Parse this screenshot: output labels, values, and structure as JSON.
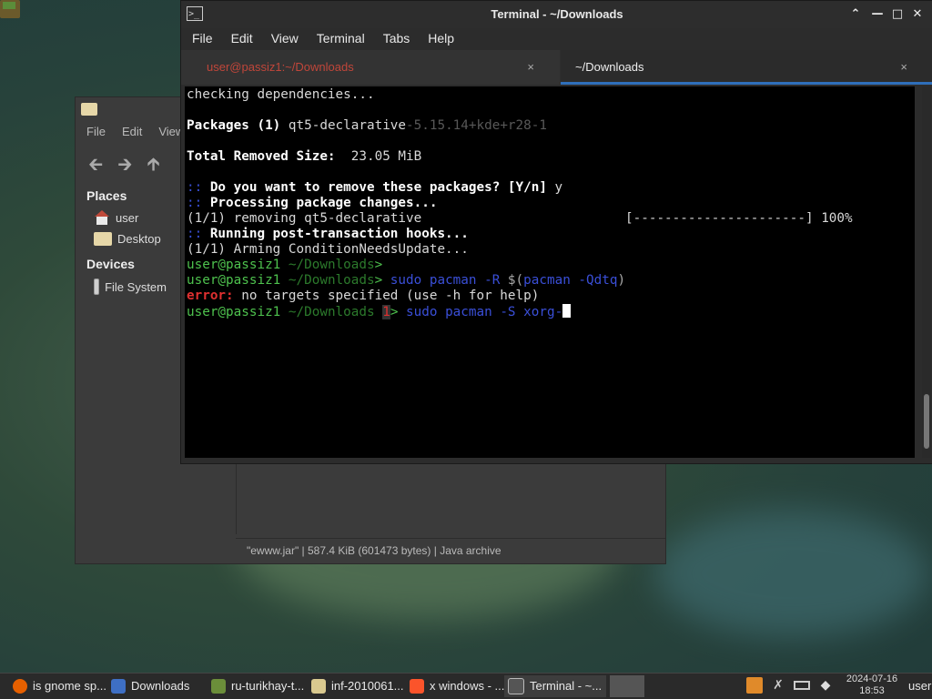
{
  "file_manager": {
    "menu": [
      "File",
      "Edit",
      "View"
    ],
    "places_header": "Places",
    "devices_header": "Devices",
    "places": [
      "user",
      "Desktop"
    ],
    "devices": [
      "File System"
    ],
    "status": "\"ewww.jar\"  |  587.4 KiB (601473 bytes)  |  Java archive"
  },
  "terminal": {
    "title": "Terminal - ~/Downloads",
    "menu": [
      "File",
      "Edit",
      "View",
      "Terminal",
      "Tabs",
      "Help"
    ],
    "tabs": [
      {
        "label": "user@passiz1:~/Downloads",
        "active": false
      },
      {
        "label": "~/Downloads",
        "active": true
      }
    ],
    "close_glyph": "×",
    "lines": {
      "l1": "checking dependencies...",
      "l3_a": "Packages (1) ",
      "l3_b": "qt5-declarative",
      "l3_c": "-5.15.14+kde+r28-1",
      "l5_a": "Total Removed Size:",
      "l5_b": "  23.05 MiB",
      "prompt_marks": "::",
      "l7": " Do you want to remove these packages? [Y/n]",
      "l7_ans": " y",
      "l8": " Processing package changes...",
      "l9": "(1/1) removing qt5-declarative                          [----------------------] 100%",
      "l10": " Running post-transaction hooks...",
      "l11": "(1/1) Arming ConditionNeedsUpdate...",
      "prompt_user": "user@passiz1",
      "prompt_dir": " ~/Downloads",
      "prompt_end": ">",
      "cmd1_a": " sudo",
      "cmd1_b": " pacman -R",
      "cmd1_c": " $(",
      "cmd1_d": "pacman",
      "cmd1_e": " -Qdtq",
      "cmd1_f": ")",
      "err_a": "error:",
      "err_b": " no targets specified (use -h for help)",
      "code": "1",
      "cmd2_a": " sudo",
      "cmd2_b": " pacman -S xorg-"
    }
  },
  "taskbar": {
    "items": [
      {
        "label": "is gnome sp...",
        "icon": "firefox-icon",
        "color": "#e66000"
      },
      {
        "label": "Downloads",
        "icon": "document-icon",
        "color": "#3e6fc4"
      },
      {
        "label": "ru-turikhay-t...",
        "icon": "java-icon",
        "color": "#6b8e3a"
      },
      {
        "label": "inf-2010061...",
        "icon": "folder-icon",
        "color": "#d9c98f"
      },
      {
        "label": "x windows - ...",
        "icon": "brave-icon",
        "color": "#fb542b"
      },
      {
        "label": "Terminal - ~...",
        "icon": "terminal-icon",
        "color": "#555555"
      }
    ],
    "date": "2024-07-16",
    "time": "18:53",
    "user": "user"
  }
}
